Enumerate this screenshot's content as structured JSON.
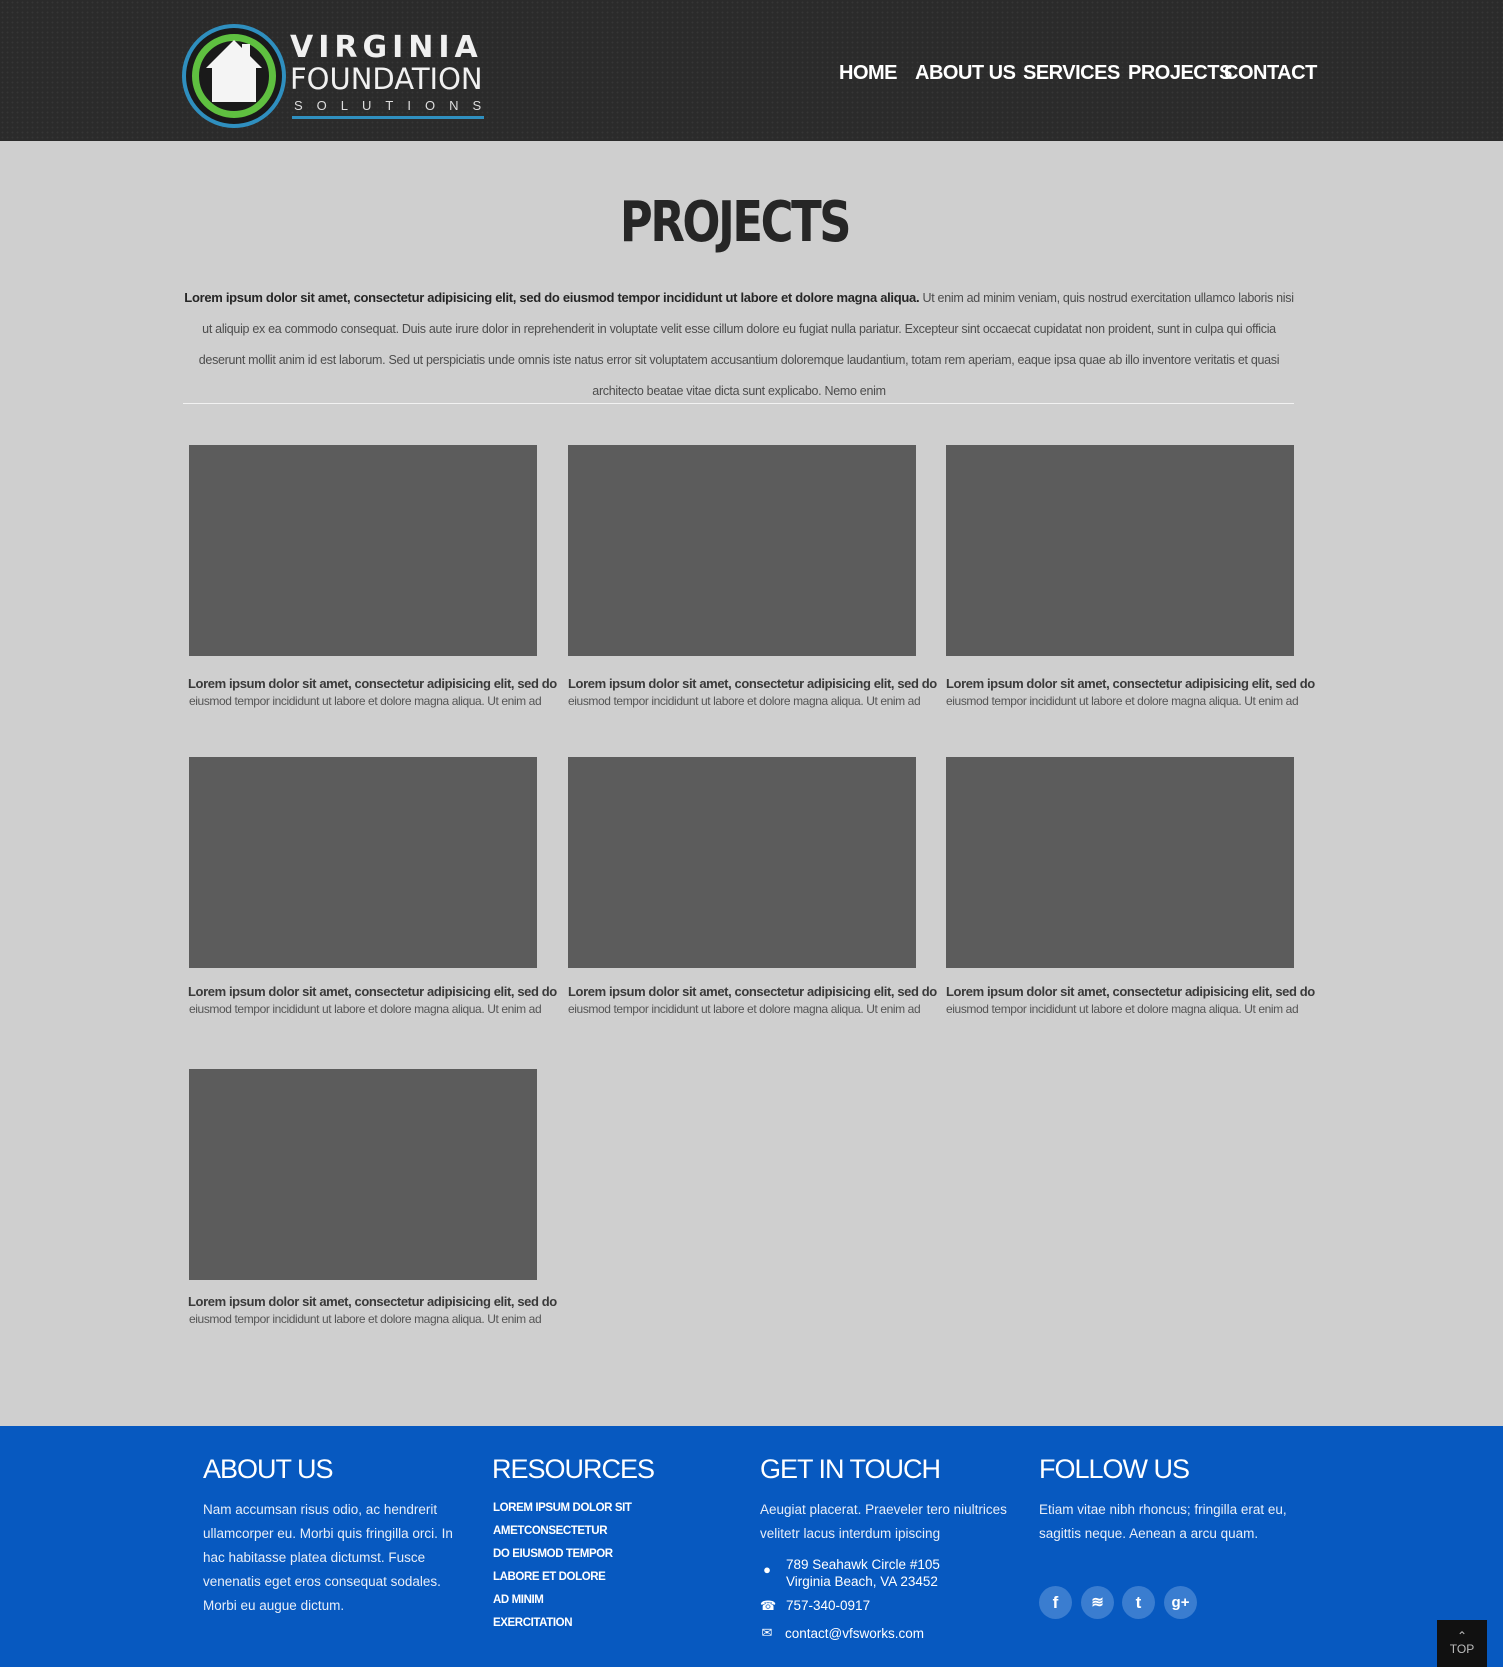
{
  "header": {
    "logo": {
      "line1": "VIRGINIA",
      "line2": "FOUNDATION",
      "line3": "SOLUTIONS"
    },
    "nav": [
      "HOME",
      "ABOUT US",
      "SERVICES",
      "PROJECTS",
      "CONTACT"
    ]
  },
  "main": {
    "title": "PROJECTS",
    "intro_bold": "Lorem ipsum dolor sit amet, consectetur adipisicing elit, sed do eiusmod tempor incididunt ut labore et dolore magna aliqua.",
    "intro_rest": "Ut enim ad minim veniam, quis nostrud exercitation ullamco laboris nisi ut aliquip ex ea commodo consequat. Duis aute irure dolor in reprehenderit in voluptate velit esse cillum dolore eu fugiat nulla pariatur. Excepteur sint occaecat cupidatat non proident, sunt in culpa qui officia deserunt mollit anim id est laborum. Sed ut perspiciatis unde omnis iste natus error sit voluptatem accusantium doloremque laudantium, totam rem aperiam, eaque ipsa quae ab illo inventore veritatis et quasi architecto beatae vitae dicta sunt explicabo. Nemo enim",
    "projects": [
      {
        "title": "Lorem ipsum dolor sit amet, consectetur adipisicing elit, sed do",
        "desc": "eiusmod tempor incididunt ut labore et dolore magna aliqua. Ut enim ad"
      },
      {
        "title": "Lorem ipsum dolor sit amet, consectetur adipisicing elit, sed do",
        "desc": "eiusmod tempor incididunt ut labore et dolore magna aliqua. Ut enim ad"
      },
      {
        "title": "Lorem ipsum dolor sit amet, consectetur adipisicing elit, sed do",
        "desc": "eiusmod tempor incididunt ut labore et dolore magna aliqua. Ut enim ad"
      },
      {
        "title": "Lorem ipsum dolor sit amet, consectetur adipisicing elit, sed do",
        "desc": "eiusmod tempor incididunt ut labore et dolore magna aliqua. Ut enim ad"
      },
      {
        "title": "Lorem ipsum dolor sit amet, consectetur adipisicing elit, sed do",
        "desc": "eiusmod tempor incididunt ut labore et dolore magna aliqua. Ut enim ad"
      },
      {
        "title": "Lorem ipsum dolor sit amet, consectetur adipisicing elit, sed do",
        "desc": "eiusmod tempor incididunt ut labore et dolore magna aliqua. Ut enim ad"
      },
      {
        "title": "Lorem ipsum dolor sit amet, consectetur adipisicing elit, sed do",
        "desc": "eiusmod tempor incididunt ut labore et dolore magna aliqua. Ut enim ad"
      }
    ]
  },
  "footer": {
    "about": {
      "heading": "ABOUT US",
      "text": "Nam accumsan risus odio, ac hendrerit ullamcorper eu. Morbi quis fringilla orci. In hac habitasse platea dictumst. Fusce venenatis eget eros consequat sodales. Morbi eu augue dictum."
    },
    "resources": {
      "heading": "RESOURCES",
      "links": [
        "LOREM IPSUM DOLOR SIT",
        "AMETCONSECTETUR",
        "DO EIUSMOD TEMPOR",
        "LABORE ET DOLORE",
        "AD MINIM",
        "EXERCITATION"
      ]
    },
    "contact": {
      "heading": "GET IN TOUCH",
      "text": "Aeugiat placerat. Praeveler tero niultrices velitetr lacus interdum ipiscing",
      "address1": "789 Seahawk Circle #105",
      "address2": "Virginia Beach, VA 23452",
      "phone": "757-340-0917",
      "email": "contact@vfsworks.com"
    },
    "follow": {
      "heading": "FOLLOW US",
      "text": "Etiam vitae nibh rhoncus; fringilla erat eu, sagittis neque. Aenean a arcu quam.",
      "social": [
        "facebook-icon",
        "rss-icon",
        "tumblr-icon",
        "google-plus-icon"
      ]
    },
    "top_label": "TOP"
  },
  "colors": {
    "header_bg": "#2b2b2b",
    "page_bg": "#cfcfcf",
    "footer_bg": "#0759c0",
    "placeholder": "#5c5c5c",
    "logo_green": "#5fc040",
    "logo_blue": "#2f8fbf"
  }
}
